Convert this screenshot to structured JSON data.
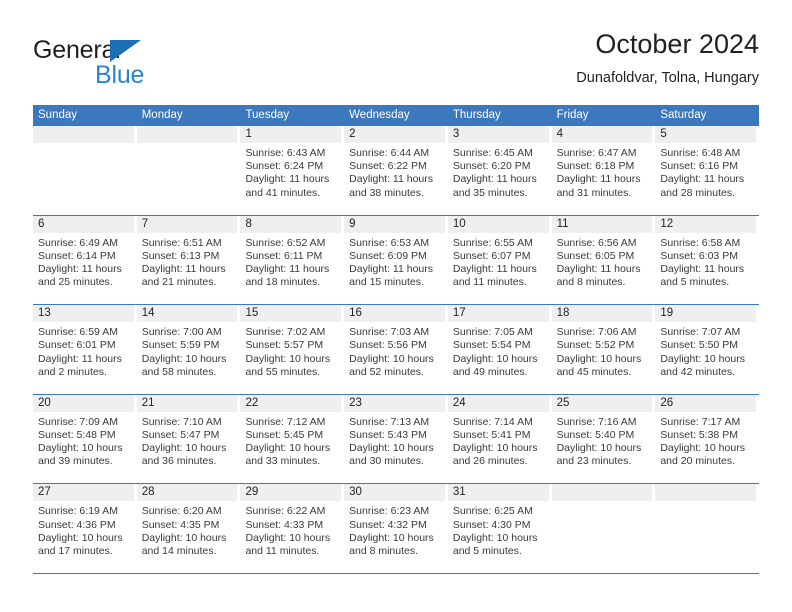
{
  "brand": {
    "word1": "General",
    "word2": "Blue",
    "triangle_color": "#1b6fb5",
    "blue_text_color": "#2a85d0"
  },
  "header": {
    "title": "October 2024",
    "subtitle": "Dunafoldvar, Tolna, Hungary"
  },
  "theme": {
    "header_blue": "#3b78bd",
    "daybar_gray": "#efefef",
    "text": "#231f20"
  },
  "weekdays": [
    "Sunday",
    "Monday",
    "Tuesday",
    "Wednesday",
    "Thursday",
    "Friday",
    "Saturday"
  ],
  "weeks": [
    [
      {
        "day": "",
        "empty": true
      },
      {
        "day": "",
        "empty": true
      },
      {
        "day": "1",
        "sunrise": "Sunrise: 6:43 AM",
        "sunset": "Sunset: 6:24 PM",
        "daylight1": "Daylight: 11 hours",
        "daylight2": "and 41 minutes."
      },
      {
        "day": "2",
        "sunrise": "Sunrise: 6:44 AM",
        "sunset": "Sunset: 6:22 PM",
        "daylight1": "Daylight: 11 hours",
        "daylight2": "and 38 minutes."
      },
      {
        "day": "3",
        "sunrise": "Sunrise: 6:45 AM",
        "sunset": "Sunset: 6:20 PM",
        "daylight1": "Daylight: 11 hours",
        "daylight2": "and 35 minutes."
      },
      {
        "day": "4",
        "sunrise": "Sunrise: 6:47 AM",
        "sunset": "Sunset: 6:18 PM",
        "daylight1": "Daylight: 11 hours",
        "daylight2": "and 31 minutes."
      },
      {
        "day": "5",
        "sunrise": "Sunrise: 6:48 AM",
        "sunset": "Sunset: 6:16 PM",
        "daylight1": "Daylight: 11 hours",
        "daylight2": "and 28 minutes."
      }
    ],
    [
      {
        "day": "6",
        "sunrise": "Sunrise: 6:49 AM",
        "sunset": "Sunset: 6:14 PM",
        "daylight1": "Daylight: 11 hours",
        "daylight2": "and 25 minutes."
      },
      {
        "day": "7",
        "sunrise": "Sunrise: 6:51 AM",
        "sunset": "Sunset: 6:13 PM",
        "daylight1": "Daylight: 11 hours",
        "daylight2": "and 21 minutes."
      },
      {
        "day": "8",
        "sunrise": "Sunrise: 6:52 AM",
        "sunset": "Sunset: 6:11 PM",
        "daylight1": "Daylight: 11 hours",
        "daylight2": "and 18 minutes."
      },
      {
        "day": "9",
        "sunrise": "Sunrise: 6:53 AM",
        "sunset": "Sunset: 6:09 PM",
        "daylight1": "Daylight: 11 hours",
        "daylight2": "and 15 minutes."
      },
      {
        "day": "10",
        "sunrise": "Sunrise: 6:55 AM",
        "sunset": "Sunset: 6:07 PM",
        "daylight1": "Daylight: 11 hours",
        "daylight2": "and 11 minutes."
      },
      {
        "day": "11",
        "sunrise": "Sunrise: 6:56 AM",
        "sunset": "Sunset: 6:05 PM",
        "daylight1": "Daylight: 11 hours",
        "daylight2": "and 8 minutes."
      },
      {
        "day": "12",
        "sunrise": "Sunrise: 6:58 AM",
        "sunset": "Sunset: 6:03 PM",
        "daylight1": "Daylight: 11 hours",
        "daylight2": "and 5 minutes."
      }
    ],
    [
      {
        "day": "13",
        "sunrise": "Sunrise: 6:59 AM",
        "sunset": "Sunset: 6:01 PM",
        "daylight1": "Daylight: 11 hours",
        "daylight2": "and 2 minutes."
      },
      {
        "day": "14",
        "sunrise": "Sunrise: 7:00 AM",
        "sunset": "Sunset: 5:59 PM",
        "daylight1": "Daylight: 10 hours",
        "daylight2": "and 58 minutes."
      },
      {
        "day": "15",
        "sunrise": "Sunrise: 7:02 AM",
        "sunset": "Sunset: 5:57 PM",
        "daylight1": "Daylight: 10 hours",
        "daylight2": "and 55 minutes."
      },
      {
        "day": "16",
        "sunrise": "Sunrise: 7:03 AM",
        "sunset": "Sunset: 5:56 PM",
        "daylight1": "Daylight: 10 hours",
        "daylight2": "and 52 minutes."
      },
      {
        "day": "17",
        "sunrise": "Sunrise: 7:05 AM",
        "sunset": "Sunset: 5:54 PM",
        "daylight1": "Daylight: 10 hours",
        "daylight2": "and 49 minutes."
      },
      {
        "day": "18",
        "sunrise": "Sunrise: 7:06 AM",
        "sunset": "Sunset: 5:52 PM",
        "daylight1": "Daylight: 10 hours",
        "daylight2": "and 45 minutes."
      },
      {
        "day": "19",
        "sunrise": "Sunrise: 7:07 AM",
        "sunset": "Sunset: 5:50 PM",
        "daylight1": "Daylight: 10 hours",
        "daylight2": "and 42 minutes."
      }
    ],
    [
      {
        "day": "20",
        "sunrise": "Sunrise: 7:09 AM",
        "sunset": "Sunset: 5:48 PM",
        "daylight1": "Daylight: 10 hours",
        "daylight2": "and 39 minutes."
      },
      {
        "day": "21",
        "sunrise": "Sunrise: 7:10 AM",
        "sunset": "Sunset: 5:47 PM",
        "daylight1": "Daylight: 10 hours",
        "daylight2": "and 36 minutes."
      },
      {
        "day": "22",
        "sunrise": "Sunrise: 7:12 AM",
        "sunset": "Sunset: 5:45 PM",
        "daylight1": "Daylight: 10 hours",
        "daylight2": "and 33 minutes."
      },
      {
        "day": "23",
        "sunrise": "Sunrise: 7:13 AM",
        "sunset": "Sunset: 5:43 PM",
        "daylight1": "Daylight: 10 hours",
        "daylight2": "and 30 minutes."
      },
      {
        "day": "24",
        "sunrise": "Sunrise: 7:14 AM",
        "sunset": "Sunset: 5:41 PM",
        "daylight1": "Daylight: 10 hours",
        "daylight2": "and 26 minutes."
      },
      {
        "day": "25",
        "sunrise": "Sunrise: 7:16 AM",
        "sunset": "Sunset: 5:40 PM",
        "daylight1": "Daylight: 10 hours",
        "daylight2": "and 23 minutes."
      },
      {
        "day": "26",
        "sunrise": "Sunrise: 7:17 AM",
        "sunset": "Sunset: 5:38 PM",
        "daylight1": "Daylight: 10 hours",
        "daylight2": "and 20 minutes."
      }
    ],
    [
      {
        "day": "27",
        "sunrise": "Sunrise: 6:19 AM",
        "sunset": "Sunset: 4:36 PM",
        "daylight1": "Daylight: 10 hours",
        "daylight2": "and 17 minutes."
      },
      {
        "day": "28",
        "sunrise": "Sunrise: 6:20 AM",
        "sunset": "Sunset: 4:35 PM",
        "daylight1": "Daylight: 10 hours",
        "daylight2": "and 14 minutes."
      },
      {
        "day": "29",
        "sunrise": "Sunrise: 6:22 AM",
        "sunset": "Sunset: 4:33 PM",
        "daylight1": "Daylight: 10 hours",
        "daylight2": "and 11 minutes."
      },
      {
        "day": "30",
        "sunrise": "Sunrise: 6:23 AM",
        "sunset": "Sunset: 4:32 PM",
        "daylight1": "Daylight: 10 hours",
        "daylight2": "and 8 minutes."
      },
      {
        "day": "31",
        "sunrise": "Sunrise: 6:25 AM",
        "sunset": "Sunset: 4:30 PM",
        "daylight1": "Daylight: 10 hours",
        "daylight2": "and 5 minutes."
      },
      {
        "day": "",
        "empty": true
      },
      {
        "day": "",
        "empty": true
      }
    ]
  ]
}
